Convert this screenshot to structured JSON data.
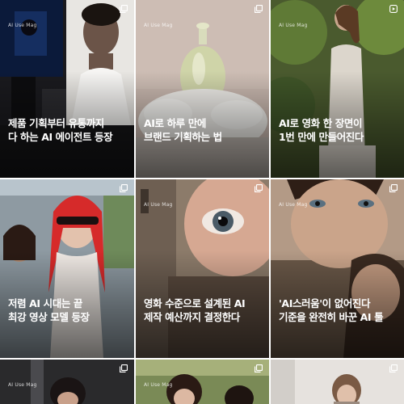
{
  "feed": {
    "posts": [
      {
        "id": "p1",
        "brand": "AI Use Mag",
        "caption_lines": [
          "제품 기획부터 유통까지",
          "다 하는 AI 에이전트 등장"
        ],
        "type_icon": "carousel-icon"
      },
      {
        "id": "p2",
        "brand": "AI Use Mag",
        "caption_lines": [
          "AI로 하루 만에",
          "브랜드 기획하는 법"
        ],
        "type_icon": "carousel-icon"
      },
      {
        "id": "p3",
        "brand": "AI Use Mag",
        "caption_lines": [
          "AI로 영화 한 장면이",
          "1번 만에 만들어진다"
        ],
        "type_icon": "reel-icon"
      },
      {
        "id": "p4",
        "brand": "AI Use Mag",
        "caption_lines": [
          "저렴 AI 시대는 끝",
          "최강 영상 모델 등장"
        ],
        "type_icon": "carousel-icon"
      },
      {
        "id": "p5",
        "brand": "AI Use Mag",
        "caption_lines": [
          "영화 수준으로 설계된 AI",
          "제작 예산까지 결정한다"
        ],
        "type_icon": "carousel-icon"
      },
      {
        "id": "p6",
        "brand": "AI Use Mag",
        "caption_lines": [
          "'AI스러움'이 없어진다",
          "기준을 완전히 바꾼 AI 툴"
        ],
        "type_icon": "carousel-icon"
      },
      {
        "id": "p7",
        "brand": "AI Use Mag",
        "caption_lines": [],
        "type_icon": "carousel-icon"
      },
      {
        "id": "p8",
        "brand": "AI Use Mag",
        "caption_lines": [],
        "type_icon": "carousel-icon"
      },
      {
        "id": "p9",
        "brand": "",
        "caption_lines": [],
        "type_icon": "carousel-icon"
      }
    ]
  }
}
